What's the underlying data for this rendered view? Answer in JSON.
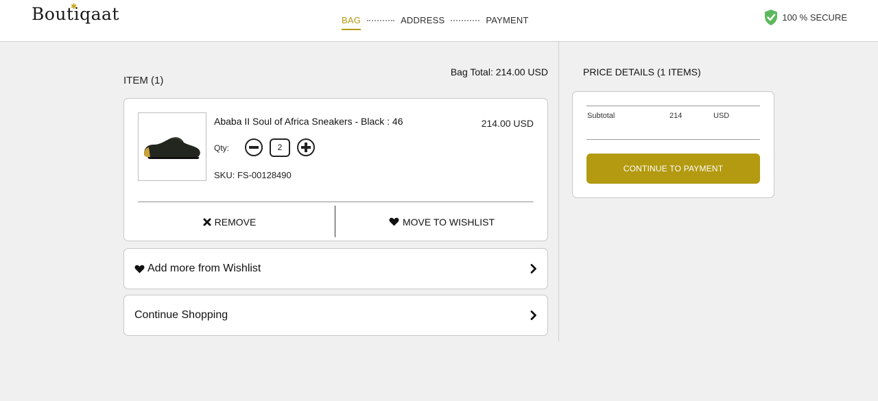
{
  "header": {
    "logo_text": "Boutiqaat",
    "steps": [
      {
        "label": "BAG"
      },
      {
        "label": "ADDRESS"
      },
      {
        "label": "PAYMENT"
      }
    ],
    "secure_label": "100 % SECURE"
  },
  "bag": {
    "items_title": "ITEM (1)",
    "total_text": "Bag Total: 214.00 USD",
    "product": {
      "name": "Ababa II Soul of Africa Sneakers - Black : 46",
      "price": "214.00 USD",
      "qty_label": "Qty:",
      "qty": "2",
      "sku": "SKU: FS-00128490",
      "image_alt": "black slip-on sneaker"
    },
    "remove_label": "REMOVE",
    "wishlist_label": "MOVE TO WISHLIST",
    "add_wishlist_label": "Add more from Wishlist",
    "continue_shopping_label": "Continue Shopping"
  },
  "price_details": {
    "title": "PRICE DETAILS (1 ITEMS)",
    "subtotal_label": "Subtotal",
    "subtotal_amount": "214",
    "subtotal_currency": "USD",
    "pay_button": "CONTINUE TO PAYMENT"
  },
  "colors": {
    "accent": "#b39a10",
    "secure_green": "#5cb85c",
    "background": "#f0f0f0"
  }
}
